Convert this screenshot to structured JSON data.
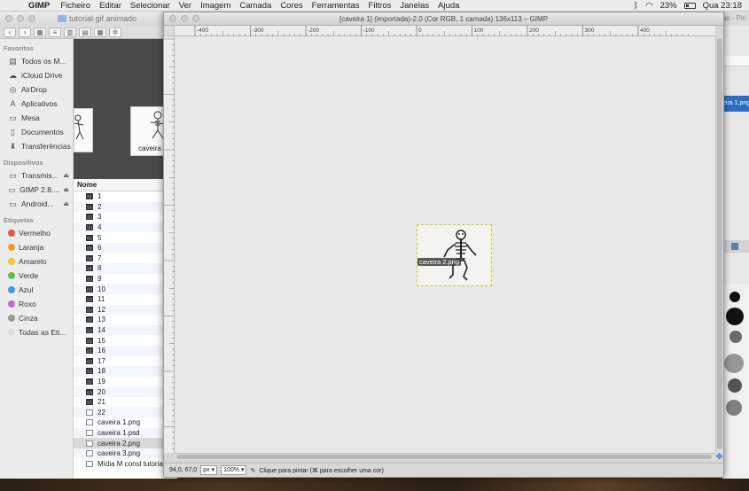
{
  "menubar": {
    "app_name": "GIMP",
    "menus": [
      "Ficheiro",
      "Editar",
      "Selecionar",
      "Ver",
      "Imagem",
      "Camada",
      "Cores",
      "Ferramentas",
      "Filtros",
      "Janelas",
      "Ajuda"
    ],
    "battery": "23%",
    "clock": "Qua 23:18",
    "icons": [
      "apple-icon",
      "bluetooth-icon",
      "wifi-icon",
      "battery-icon"
    ]
  },
  "finder": {
    "title": "tutorial gif animado",
    "sidebar": {
      "favorites_header": "Favoritos",
      "favorites": [
        "Todos os M...",
        "iCloud Drive",
        "AirDrop",
        "Aplicativos",
        "Mesa",
        "Documentos",
        "Transferências"
      ],
      "devices_header": "Dispositivos",
      "devices": [
        "Transmis...",
        "GIMP 2.8....",
        "Android..."
      ],
      "tags_header": "Etiquetas",
      "tags": [
        {
          "label": "Vermelho",
          "color": "#f0533f"
        },
        {
          "label": "Laranja",
          "color": "#f39a2b"
        },
        {
          "label": "Amarelo",
          "color": "#f2c531"
        },
        {
          "label": "Verde",
          "color": "#5ec14a"
        },
        {
          "label": "Azul",
          "color": "#3a9be6"
        },
        {
          "label": "Roxo",
          "color": "#b86bd4"
        },
        {
          "label": "Cinza",
          "color": "#9a9a9a"
        },
        {
          "label": "Todas as Eti...",
          "color": "#dcdcdc"
        }
      ]
    },
    "preview_caption": "caveira",
    "list_header": "Nome",
    "files": [
      "1",
      "2",
      "3",
      "4",
      "5",
      "6",
      "7",
      "8",
      "9",
      "10",
      "11",
      "12",
      "13",
      "14",
      "15",
      "16",
      "17",
      "18",
      "19",
      "20",
      "21",
      "22",
      "caveira 1.png",
      "caveira 1.psd",
      "caveira 2.png",
      "caveira 3.png",
      "Mídia M consl tutorial"
    ]
  },
  "gimp": {
    "title": "[caveira 1] (importada)-2.0 (Cor RGB, 1 camada) 136x113 – GIMP",
    "ruler_ticks": [
      "-400",
      "-300",
      "-200",
      "-100",
      "0",
      "100",
      "200",
      "300",
      "400"
    ],
    "layer_label": "caveira 2.png",
    "status": {
      "coords": "94,0, 67,0",
      "unit": "px",
      "zoom": "100%",
      "hint": "Clique para pintar (⌘ para escolher uma cor)"
    }
  },
  "background_window": {
    "title_fragment": "as - Pin",
    "selected_fragment": "eira 1.png"
  }
}
